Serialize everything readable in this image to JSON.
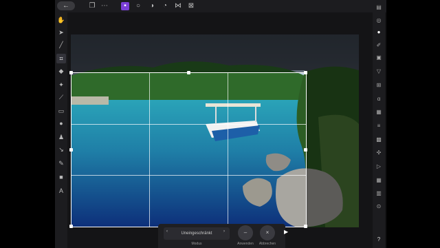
{
  "topbar": {
    "back_icon": "arrow-left-icon"
  },
  "context_toolbar": {
    "mode_value": "Uneingeschränkt",
    "mode_label": "Modus",
    "prev": "‹",
    "next": "›",
    "apply_label": "Anwenden",
    "cancel_label": "Abbrechen",
    "apply_glyph": "–",
    "cancel_glyph": "×"
  },
  "help": "?",
  "colors": {
    "accent": "#7b3fd6",
    "panel": "#1c1c1f"
  }
}
